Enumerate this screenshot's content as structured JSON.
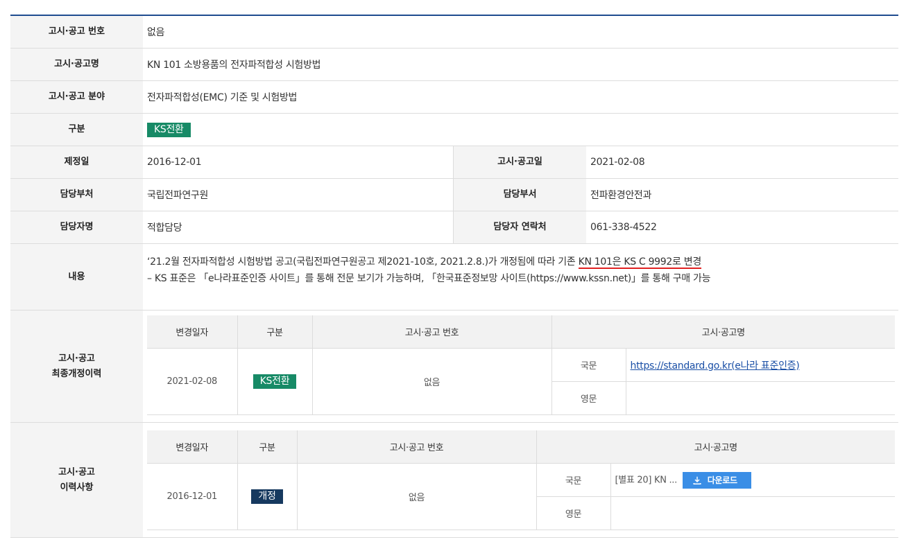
{
  "rows": {
    "notice_no": {
      "label": "고시·공고 번호",
      "value": "없음"
    },
    "notice_name": {
      "label": "고시·공고명",
      "value": "KN 101 소방용품의 전자파적합성 시험방법"
    },
    "notice_field": {
      "label": "고시·공고 분야",
      "value": "전자파적합성(EMC) 기준 및 시험방법"
    },
    "category": {
      "label": "구분",
      "value": "KS전환"
    },
    "enact_date": {
      "label": "제정일",
      "value": "2016-12-01"
    },
    "notice_date": {
      "label": "고시·공고일",
      "value": "2021-02-08"
    },
    "dept": {
      "label": "담당부처",
      "value": "국립전파연구원"
    },
    "division": {
      "label": "담당부서",
      "value": "전파환경안전과"
    },
    "manager": {
      "label": "담당자명",
      "value": "적합담당"
    },
    "contact": {
      "label": "담당자 연락처",
      "value": "061-338-4522"
    },
    "content": {
      "label": "내용",
      "line1_pre": "‘21.2월 전자파적합성 시험방법 공고(국립전파연구원공고 제2021-10호, 2021.2.8.)가 개정됨에 따라 기존 ",
      "line1_highlight": "KN 101은 KS C 9992로 변경",
      "line2": "– KS 표준은 「e나라표준인증 사이트」를 통해 전문 보기가 가능하며, 「한국표준정보망 사이트(https://www.kssn.net)」를 통해 구매 가능"
    }
  },
  "latest_revision": {
    "label_line1": "고시·공고",
    "label_line2": "최종개정이력",
    "headers": [
      "변경일자",
      "구분",
      "고시·공고 번호",
      "고시·공고명"
    ],
    "date": "2021-02-08",
    "category": "KS전환",
    "notice_no": "없음",
    "kor_label": "국문",
    "eng_label": "영문",
    "kor_link": "https://standard.go.kr(e나라 표준인증)"
  },
  "history": {
    "label_line1": "고시·공고",
    "label_line2": "이력사항",
    "headers": [
      "변경일자",
      "구분",
      "고시·공고 번호",
      "고시·공고명"
    ],
    "date": "2016-12-01",
    "category": "개정",
    "notice_no": "없음",
    "kor_label": "국문",
    "eng_label": "영문",
    "kor_file": "[별표 20] KN ...",
    "download_label": "다운로드"
  },
  "colors": {
    "accent_border": "#1e4b8f",
    "badge_ks": "#178a66",
    "badge_revision": "#16395f",
    "download_button": "#3a8ee6",
    "highlight_underline": "#e02020",
    "link": "#1a4fa6"
  }
}
